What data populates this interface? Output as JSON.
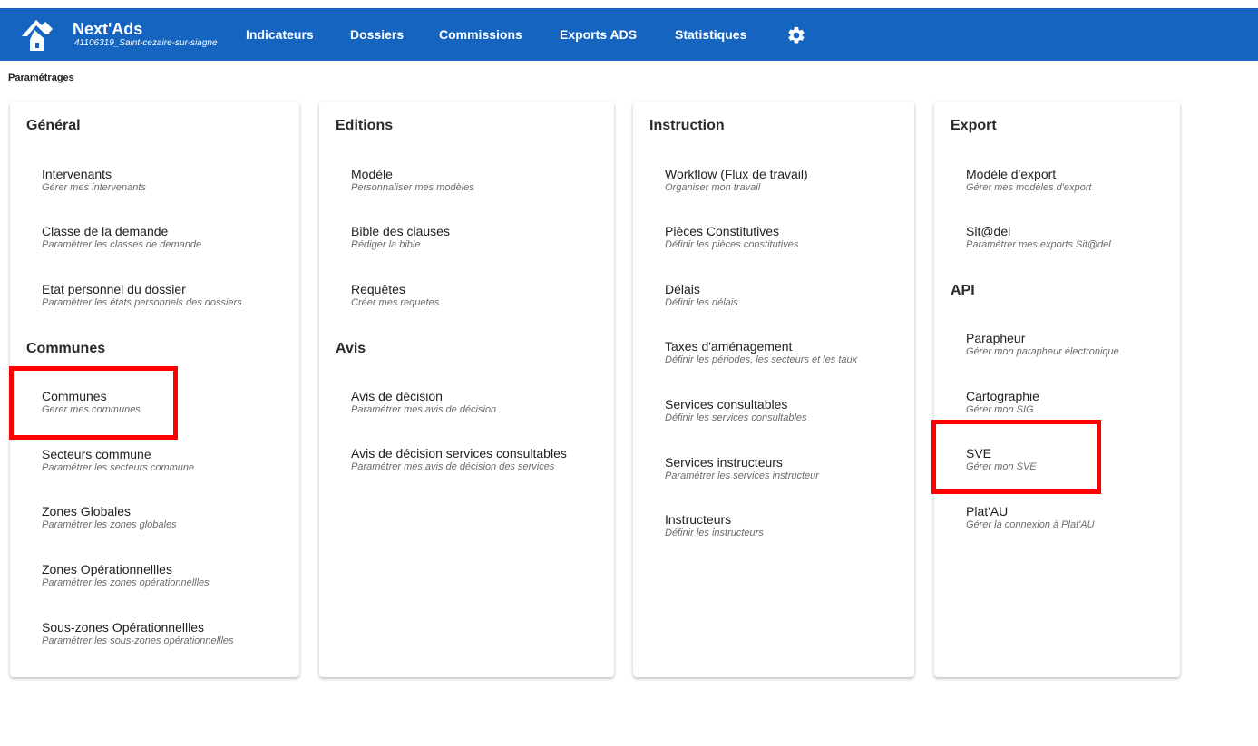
{
  "header": {
    "app_name": "Next'Ads",
    "commune": "41106319_Saint-cezaire-sur-siagne",
    "nav": [
      "Indicateurs",
      "Dossiers",
      "Commissions",
      "Exports ADS",
      "Statistiques"
    ],
    "settings_icon": "gear-icon",
    "colors": {
      "bar": "#1565c0",
      "text": "#ffffff"
    }
  },
  "page": {
    "title": "Paramétrages"
  },
  "cards": [
    {
      "sections": [
        {
          "title": "Général",
          "items": [
            {
              "title": "Intervenants",
              "subtitle": "Gérer mes intervenants"
            },
            {
              "title": "Classe de la demande",
              "subtitle": "Paramétrer les classes de demande"
            },
            {
              "title": "Etat personnel du dossier",
              "subtitle": "Paramétrer les états personnels des dossiers"
            }
          ]
        },
        {
          "title": "Communes",
          "items": [
            {
              "title": "Communes",
              "subtitle": "Gerer mes communes"
            },
            {
              "title": "Secteurs commune",
              "subtitle": "Paramétrer les secteurs commune"
            },
            {
              "title": "Zones Globales",
              "subtitle": "Paramétrer les zones globales"
            },
            {
              "title": "Zones Opérationnellles",
              "subtitle": "Paramétrer les zones opérationnellles"
            },
            {
              "title": "Sous-zones Opérationnellles",
              "subtitle": "Paramétrer les sous-zones opérationnellles"
            }
          ]
        }
      ]
    },
    {
      "sections": [
        {
          "title": "Editions",
          "items": [
            {
              "title": "Modèle",
              "subtitle": "Personnaliser mes modèles"
            },
            {
              "title": "Bible des clauses",
              "subtitle": "Rédiger la bible"
            },
            {
              "title": "Requêtes",
              "subtitle": "Créer mes requetes"
            }
          ]
        },
        {
          "title": "Avis",
          "items": [
            {
              "title": "Avis de décision",
              "subtitle": "Paramétrer mes avis de décision"
            },
            {
              "title": "Avis de décision services consultables",
              "subtitle": "Paramétrer mes avis de décision des services"
            }
          ]
        }
      ]
    },
    {
      "sections": [
        {
          "title": "Instruction",
          "items": [
            {
              "title": "Workflow (Flux de travail)",
              "subtitle": "Organiser mon travail"
            },
            {
              "title": "Pièces Constitutives",
              "subtitle": "Définir les pièces constitutives"
            },
            {
              "title": "Délais",
              "subtitle": "Définir les délais"
            },
            {
              "title": "Taxes d'aménagement",
              "subtitle": "Définir les périodes, les secteurs et les taux"
            },
            {
              "title": "Services consultables",
              "subtitle": "Définir les services consultables"
            },
            {
              "title": "Services instructeurs",
              "subtitle": "Paramétrer les services instructeur"
            },
            {
              "title": "Instructeurs",
              "subtitle": "Définir les instructeurs"
            }
          ]
        }
      ]
    },
    {
      "sections": [
        {
          "title": "Export",
          "items": [
            {
              "title": "Modèle d'export",
              "subtitle": "Gérer mes modèles d'export"
            },
            {
              "title": "Sit@del",
              "subtitle": "Paramétrer mes exports Sit@del"
            }
          ]
        },
        {
          "title": "API",
          "items": [
            {
              "title": "Parapheur",
              "subtitle": "Gérer mon parapheur électronique"
            },
            {
              "title": "Cartographie",
              "subtitle": "Gérer mon SIG"
            },
            {
              "title": "SVE",
              "subtitle": "Gérer mon SVE"
            },
            {
              "title": "Plat'AU",
              "subtitle": "Gérer la connexion à Plat'AU"
            }
          ]
        }
      ]
    }
  ],
  "annotations": {
    "highlight_color": "#ff0000"
  }
}
